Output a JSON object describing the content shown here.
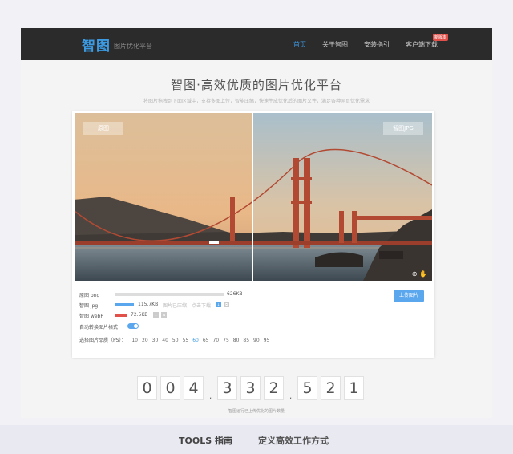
{
  "nav": {
    "logo": "智图",
    "logo_sub": "图片优化平台",
    "items": [
      {
        "label": "首页",
        "active": true
      },
      {
        "label": "关于智图",
        "active": false
      },
      {
        "label": "安装指引",
        "active": false
      },
      {
        "label": "客户端下载",
        "active": false
      }
    ],
    "badge": "新版本"
  },
  "hero": {
    "title": "智图·高效优质的图片优化平台",
    "subtitle": "将图片拖拽到下面区域中，支持多图上传，智能压缩，快速生成优化后的图片文件，满足各种网页优化需求"
  },
  "compare": {
    "left_label": "原图",
    "right_label": "智图JPG",
    "zoom_icon": "zoom-icon",
    "hand_icon": "hand-icon"
  },
  "results": [
    {
      "name": "原图 png",
      "size": "626KB",
      "color": "#dddddd",
      "fill": 1.0,
      "note": ""
    },
    {
      "name": "智图 jpg",
      "size": "115.7KB",
      "color": "#5aa7ee",
      "fill": 0.18,
      "note": "图片已压缩，点击下载"
    },
    {
      "name": "智图 webP",
      "size": "72.5KB",
      "color": "#e2504a",
      "fill": 0.12,
      "note": ""
    }
  ],
  "upload_label": "上传图片",
  "auto_format_label": "自动转换图片格式",
  "quality": {
    "label": "选择图片品质（PS）：",
    "options": [
      "10",
      "20",
      "30",
      "40",
      "50",
      "55",
      "60",
      "65",
      "70",
      "75",
      "80",
      "85",
      "90",
      "95"
    ],
    "selected": "60"
  },
  "counter": {
    "digits": [
      "0",
      "0",
      "4",
      "3",
      "3",
      "2",
      "5",
      "2",
      "1"
    ],
    "label": "智图运行已上传优化的图片数量"
  },
  "footer": {
    "brand": "TOOLS 指南",
    "slogan": "定义高效工作方式"
  }
}
